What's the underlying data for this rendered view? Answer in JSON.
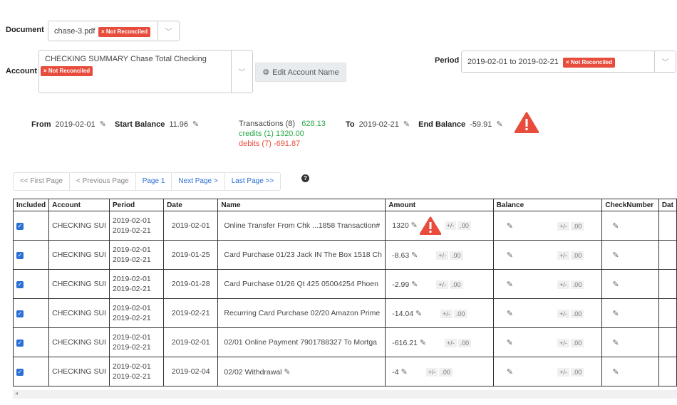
{
  "document": {
    "label": "Document",
    "value": "chase-3.pdf",
    "status": "Not Reconciled"
  },
  "account": {
    "label": "Account",
    "value": "CHECKING SUMMARY Chase Total Checking",
    "status": "Not Reconciled",
    "edit_button": "Edit Account Name"
  },
  "period": {
    "label": "Period",
    "value": "2019-02-01 to 2019-02-21",
    "status": "Not Reconciled"
  },
  "summary": {
    "from_label": "From",
    "from": "2019-02-01",
    "start_label": "Start Balance",
    "start": "11.96",
    "transactions": "Transactions (8)",
    "transactions_total": "628.13",
    "credits": "credits (1) 1320.00",
    "debits": "debits (7) -691.87",
    "to_label": "To",
    "to": "2019-02-21",
    "end_label": "End Balance",
    "end": "-59.91"
  },
  "colors": {
    "danger": "#e74c3c",
    "credit": "#28a745",
    "link": "#2a6fd6"
  },
  "pager": [
    "<< First Page",
    "< Previous Page",
    "Page 1",
    "Next Page >",
    "Last Page >>"
  ],
  "table": {
    "headers": [
      "Included",
      "Account",
      "Period",
      "Date",
      "Name",
      "Amount",
      "Balance",
      "CheckNumber",
      "Dat"
    ],
    "pm": "+/-",
    "zero": ".00",
    "rows": [
      {
        "account": "CHECKING SUI",
        "p1": "2019-02-01",
        "p2": "2019-02-21",
        "date": "2019-02-01",
        "name": "Online Transfer From Chk ...1858 Transaction#",
        "amount": "1320",
        "warn": true
      },
      {
        "account": "CHECKING SUI",
        "p1": "2019-02-01",
        "p2": "2019-02-21",
        "date": "2019-01-25",
        "name": "Card Purchase 01/23 Jack IN The Box 1518 Ch",
        "amount": "-8.63"
      },
      {
        "account": "CHECKING SUI",
        "p1": "2019-02-01",
        "p2": "2019-02-21",
        "date": "2019-01-28",
        "name": "Card Purchase 01/26 Qt 425 05004254 Phoen",
        "amount": "-2.99"
      },
      {
        "account": "CHECKING SUI",
        "p1": "2019-02-01",
        "p2": "2019-02-21",
        "date": "2019-02-21",
        "name": "Recurring Card Purchase 02/20 Amazon Prime",
        "amount": "-14.04"
      },
      {
        "account": "CHECKING SUI",
        "p1": "2019-02-01",
        "p2": "2019-02-21",
        "date": "2019-02-01",
        "name": "02/01 Online Payment 7901788327 To Mortga",
        "amount": "-616.21"
      },
      {
        "account": "CHECKING SUI",
        "p1": "2019-02-01",
        "p2": "2019-02-21",
        "date": "2019-02-04",
        "name": "02/02 Withdrawal",
        "amount": "-4",
        "name_edit": true
      }
    ]
  }
}
